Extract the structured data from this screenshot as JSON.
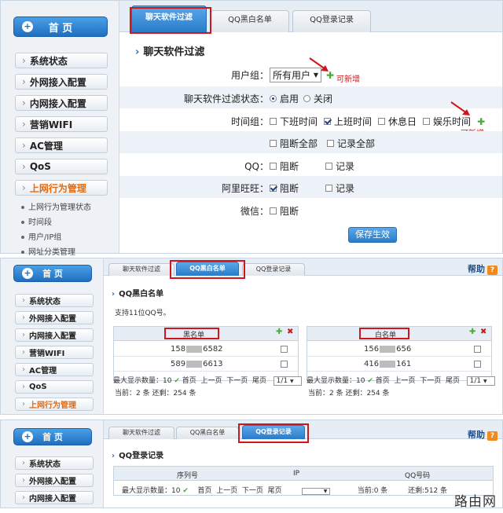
{
  "sidebar": {
    "home": "首 页",
    "items": [
      "系统状态",
      "外网接入配置",
      "内网接入配置",
      "营销WIFI",
      "AC管理",
      "QoS",
      "上网行为管理"
    ],
    "sub_items": [
      "上网行为管理状态",
      "时间段",
      "用户/IP组",
      "网址分类管理"
    ]
  },
  "tabs": [
    "聊天软件过滤",
    "QQ黑白名单",
    "QQ登录记录"
  ],
  "help": "帮助",
  "panel1": {
    "title": "聊天软件过滤",
    "user_group_label": "用户组：",
    "user_group_value": "所有用户",
    "can_add": "可新增",
    "status_label": "聊天软件过滤状态：",
    "status_on": "启用",
    "status_off": "关闭",
    "time_group_label": "时间组：",
    "time_options": [
      "下班时间",
      "上班时间",
      "休息日",
      "娱乐时间"
    ],
    "block_all": "阻断全部",
    "record_all": "记录全部",
    "qq_label": "QQ：",
    "aliww_label": "阿里旺旺：",
    "wechat_label": "微信：",
    "block": "阻断",
    "record": "记录",
    "save": "保存生效"
  },
  "panel2": {
    "title": "QQ黑白名单",
    "support": "支持11位QQ号。",
    "black_header": "黑名单",
    "white_header": "白名单",
    "black_rows": [
      [
        "158",
        "6582"
      ],
      [
        "589",
        "6613"
      ]
    ],
    "white_rows": [
      [
        "156",
        "656"
      ],
      [
        "416",
        "161"
      ]
    ],
    "max_show": "最大显示数量：",
    "max_value": "10",
    "first": "首页",
    "prev": "上一页",
    "next": "下一页",
    "last": "尾页",
    "page": "1/1",
    "status": "当前：2 条  还剩：254 条"
  },
  "panel3": {
    "title": "QQ登录记录",
    "cols": [
      "序列号",
      "IP",
      "QQ号码"
    ],
    "max_show": "最大显示数量：",
    "max_value": "10",
    "first": "首页",
    "prev": "上一页",
    "next": "下一页",
    "last": "尾页",
    "current": "当前:0 条",
    "remain": "还剩:512 条"
  },
  "watermark": "路由网"
}
